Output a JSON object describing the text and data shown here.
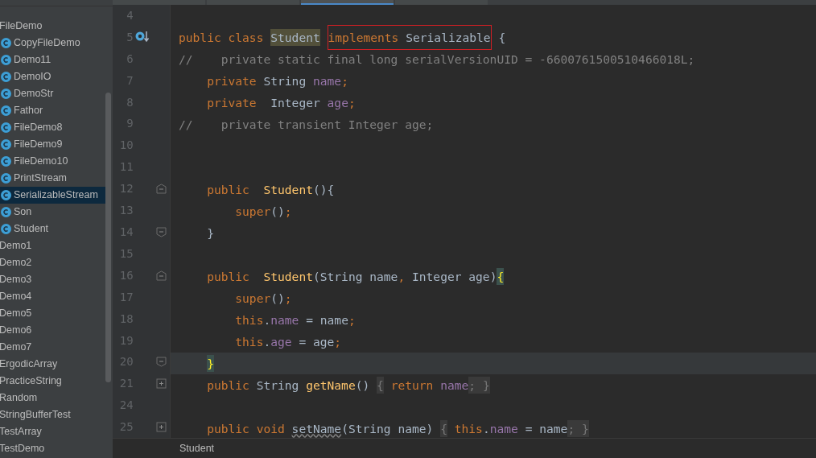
{
  "tabs": [
    {
      "selected": false
    },
    {
      "selected": false
    },
    {
      "selected": true
    },
    {
      "selected": false
    }
  ],
  "sidebar": {
    "items": [
      {
        "label": "FileDemo",
        "kind": "package"
      },
      {
        "label": "CopyFileDemo",
        "kind": "class",
        "selected": false
      },
      {
        "label": "Demo11",
        "kind": "class",
        "selected": false
      },
      {
        "label": "DemoIO",
        "kind": "class",
        "selected": false
      },
      {
        "label": "DemoStr",
        "kind": "class",
        "selected": false
      },
      {
        "label": "Fathor",
        "kind": "class",
        "selected": false
      },
      {
        "label": "FileDemo8",
        "kind": "class",
        "selected": false
      },
      {
        "label": "FileDemo9",
        "kind": "class",
        "selected": false
      },
      {
        "label": "FileDemo10",
        "kind": "class",
        "selected": false
      },
      {
        "label": "PrintStream",
        "kind": "class",
        "selected": false
      },
      {
        "label": "SerializableStream",
        "kind": "class",
        "selected": true
      },
      {
        "label": "Son",
        "kind": "class",
        "selected": false
      },
      {
        "label": "Student",
        "kind": "class",
        "selected": false
      },
      {
        "label": "Demo1",
        "kind": "package"
      },
      {
        "label": "Demo2",
        "kind": "package"
      },
      {
        "label": "Demo3",
        "kind": "package"
      },
      {
        "label": "Demo4",
        "kind": "package"
      },
      {
        "label": "Demo5",
        "kind": "package"
      },
      {
        "label": "Demo6",
        "kind": "package"
      },
      {
        "label": "Demo7",
        "kind": "package"
      },
      {
        "label": "ErgodicArray",
        "kind": "package"
      },
      {
        "label": "PracticeString",
        "kind": "package"
      },
      {
        "label": "Random",
        "kind": "package"
      },
      {
        "label": "StringBufferTest",
        "kind": "package"
      },
      {
        "label": "TestArray",
        "kind": "package"
      },
      {
        "label": "TestDemo",
        "kind": "package"
      }
    ]
  },
  "editor": {
    "lines": [
      {
        "number": "4",
        "current": false
      },
      {
        "number": "5",
        "marker": {
          "kind": "implemented"
        },
        "current": false,
        "tokens": [
          {
            "text": "public class ",
            "kind": "keyword"
          },
          {
            "text": "Student ",
            "kind": "usage"
          },
          {
            "kind": "boxed",
            "children": [
              {
                "text": "implements ",
                "kind": "keyword"
              },
              {
                "text": "Serializable",
                "kind": "plain"
              }
            ]
          },
          {
            "text": " {",
            "kind": "plain"
          }
        ]
      },
      {
        "number": "6",
        "current": false,
        "tokens": [
          {
            "text": "//    private static final long serialVersionUID = -6600761500510466018L;",
            "kind": "comment"
          }
        ]
      },
      {
        "number": "7",
        "current": false,
        "tokens": [
          {
            "text": "    private ",
            "kind": "keyword"
          },
          {
            "text": "String ",
            "kind": "plain"
          },
          {
            "text": "name",
            "kind": "field"
          },
          {
            "text": ";",
            "kind": "keyword"
          }
        ]
      },
      {
        "number": "8",
        "current": false,
        "tokens": [
          {
            "text": "    private  ",
            "kind": "keyword"
          },
          {
            "text": "Integer ",
            "kind": "plain"
          },
          {
            "text": "age",
            "kind": "field"
          },
          {
            "text": ";",
            "kind": "keyword"
          }
        ]
      },
      {
        "number": "9",
        "current": false,
        "tokens": [
          {
            "text": "//    private transient Integer age;",
            "kind": "comment"
          }
        ]
      },
      {
        "number": "10",
        "current": false
      },
      {
        "number": "11",
        "current": false
      },
      {
        "number": "12",
        "fold": {
          "kind": "open"
        },
        "current": false,
        "tokens": [
          {
            "text": "    public  ",
            "kind": "keyword"
          },
          {
            "text": "Student",
            "kind": "method"
          },
          {
            "text": "(){",
            "kind": "plain"
          }
        ]
      },
      {
        "number": "13",
        "current": false,
        "tokens": [
          {
            "text": "        super",
            "kind": "keyword"
          },
          {
            "text": "()",
            "kind": "plain"
          },
          {
            "text": ";",
            "kind": "keyword"
          }
        ]
      },
      {
        "number": "14",
        "fold": {
          "kind": "close"
        },
        "current": false,
        "tokens": [
          {
            "text": "    }",
            "kind": "plain"
          }
        ]
      },
      {
        "number": "15",
        "current": false
      },
      {
        "number": "16",
        "fold": {
          "kind": "open"
        },
        "current": false,
        "tokens": [
          {
            "text": "    public  ",
            "kind": "keyword"
          },
          {
            "text": "Student",
            "kind": "method"
          },
          {
            "text": "(String name",
            "kind": "plain"
          },
          {
            "text": ", ",
            "kind": "keyword"
          },
          {
            "text": "Integer age)",
            "kind": "plain"
          },
          {
            "text": "{",
            "kind": "brace"
          }
        ]
      },
      {
        "number": "17",
        "current": false,
        "tokens": [
          {
            "text": "        super",
            "kind": "keyword"
          },
          {
            "text": "()",
            "kind": "plain"
          },
          {
            "text": ";",
            "kind": "keyword"
          }
        ]
      },
      {
        "number": "18",
        "current": false,
        "tokens": [
          {
            "text": "        this",
            "kind": "keyword"
          },
          {
            "text": ".",
            "kind": "plain"
          },
          {
            "text": "name",
            "kind": "field"
          },
          {
            "text": " = name",
            "kind": "plain"
          },
          {
            "text": ";",
            "kind": "keyword"
          }
        ]
      },
      {
        "number": "19",
        "current": false,
        "tokens": [
          {
            "text": "        this",
            "kind": "keyword"
          },
          {
            "text": ".",
            "kind": "plain"
          },
          {
            "text": "age",
            "kind": "field"
          },
          {
            "text": " = age",
            "kind": "plain"
          },
          {
            "text": ";",
            "kind": "keyword"
          }
        ]
      },
      {
        "number": "20",
        "fold": {
          "kind": "close"
        },
        "current": true,
        "tokens": [
          {
            "text": "    }",
            "kind": "brace"
          }
        ]
      },
      {
        "number": "21",
        "fold": {
          "kind": "plus"
        },
        "current": false,
        "tokens": [
          {
            "text": "    public ",
            "kind": "keyword"
          },
          {
            "text": "String ",
            "kind": "plain"
          },
          {
            "text": "getName",
            "kind": "method"
          },
          {
            "text": "() ",
            "kind": "plain"
          },
          {
            "text": "{ ",
            "kind": "folded"
          },
          {
            "text": "return ",
            "kind": "keyword"
          },
          {
            "text": "name",
            "kind": "field"
          },
          {
            "text": "; }",
            "kind": "folded"
          }
        ]
      },
      {
        "number": "24",
        "current": false
      },
      {
        "number": "25",
        "fold": {
          "kind": "plus"
        },
        "current": false,
        "tokens": [
          {
            "text": "    public void ",
            "kind": "keyword"
          },
          {
            "text": "setName",
            "kind": "unused"
          },
          {
            "text": "(String name) ",
            "kind": "plain"
          },
          {
            "text": "{ ",
            "kind": "folded"
          },
          {
            "text": "this",
            "kind": "keyword"
          },
          {
            "text": ".",
            "kind": "plain"
          },
          {
            "text": "name",
            "kind": "field"
          },
          {
            "text": " = name",
            "kind": "plain"
          },
          {
            "text": "; }",
            "kind": "folded"
          }
        ]
      }
    ]
  },
  "breadcrumb": "Student"
}
